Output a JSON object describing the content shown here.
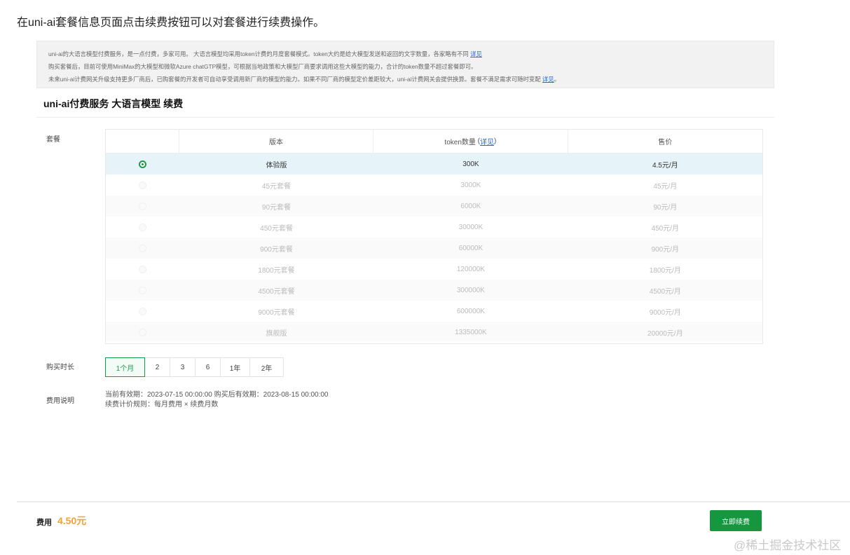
{
  "intro": "在uni-ai套餐信息页面点击续费按钮可以对套餐进行续费操作。",
  "notice": {
    "line1": "uni-ai的大语言模型付费服务，是一点付费，多家可用。 大语言模型均采用token计费的月度套餐模式。token大约是给大模型发送和返回的文字数量，各家略有不同",
    "line1_link": "详见",
    "line2": "购买套餐后，目前可使用MiniMax的大模型和微软Azure chatGTP模型，可根据当地政策和大模型厂商要求调用这些大模型的能力，合计的token数量不超过套餐即可。",
    "line3": "未来uni-ai计费网关升级支持更多厂商后，已购套餐的开发者可自动享受调用新厂商的模型的能力。如果不同厂商的模型定价差距较大，uni-ai计费网关会提供换算。套餐不满足需求可随时变配",
    "line3_link": "详见",
    "line3_tail": "。"
  },
  "page_title": "uni-ai付费服务 大语言模型 续费",
  "labels": {
    "package": "套餐",
    "duration": "购买时长",
    "fee_desc": "费用说明"
  },
  "table": {
    "headers": {
      "version": "版本",
      "token": "token数量",
      "token_link": "详见",
      "price": "售价"
    },
    "rows": [
      {
        "version": "体验版",
        "token": "300K",
        "price": "4.5元/月",
        "selected": true
      },
      {
        "version": "45元套餐",
        "token": "3000K",
        "price": "45元/月",
        "selected": false
      },
      {
        "version": "90元套餐",
        "token": "6000K",
        "price": "90元/月",
        "selected": false
      },
      {
        "version": "450元套餐",
        "token": "30000K",
        "price": "450元/月",
        "selected": false
      },
      {
        "version": "900元套餐",
        "token": "60000K",
        "price": "900元/月",
        "selected": false
      },
      {
        "version": "1800元套餐",
        "token": "120000K",
        "price": "1800元/月",
        "selected": false
      },
      {
        "version": "4500元套餐",
        "token": "300000K",
        "price": "4500元/月",
        "selected": false
      },
      {
        "version": "9000元套餐",
        "token": "600000K",
        "price": "9000元/月",
        "selected": false
      },
      {
        "version": "旗舰版",
        "token": "1335000K",
        "price": "20000元/月",
        "selected": false
      }
    ]
  },
  "durations": [
    {
      "label": "1个月",
      "active": true
    },
    {
      "label": "2",
      "active": false
    },
    {
      "label": "3",
      "active": false
    },
    {
      "label": "6",
      "active": false
    },
    {
      "label": "1年",
      "active": false
    },
    {
      "label": "2年",
      "active": false
    }
  ],
  "fee_info": {
    "line1": "当前有效期：2023-07-15 00:00:00 购买后有效期：2023-08-15 00:00:00",
    "line2": "续费计价规则：每月费用 × 续费月数"
  },
  "footer": {
    "fee_label": "费用",
    "fee_value": "4.50元",
    "renew_button": "立即续费"
  },
  "watermark": "@稀土掘金技术社区",
  "colors": {
    "accent": "#16973f",
    "price": "#f0a23a",
    "link": "#2563d9",
    "selected_row": "#e6f4fa"
  }
}
